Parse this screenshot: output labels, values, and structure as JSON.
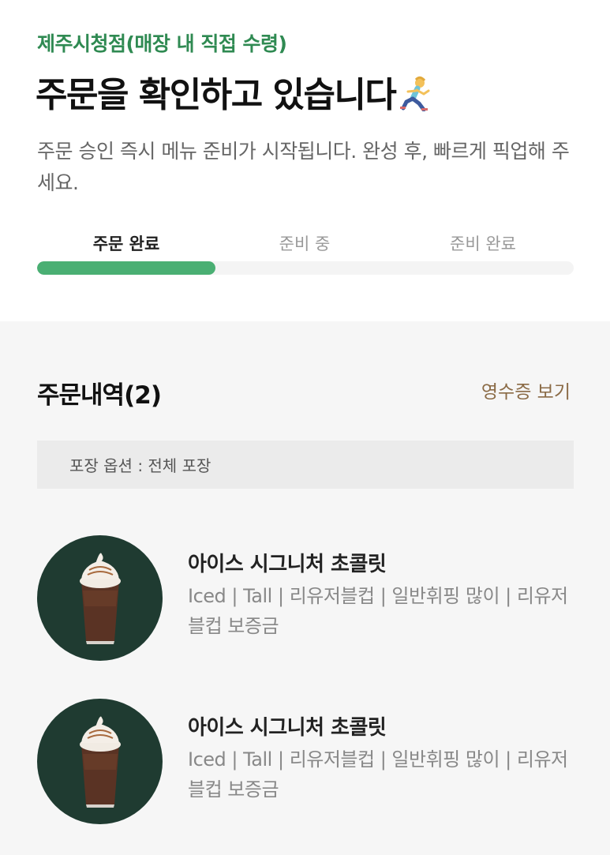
{
  "header": {
    "store": "제주시청점(매장 내 직접 수령)",
    "title": "주문을 확인하고 있습니다",
    "description": "주문 승인 즉시 메뉴 준비가 시작됩니다. 완성 후, 빠르게 픽업해 주세요."
  },
  "progress": {
    "steps": [
      {
        "label": "주문 완료",
        "active": true
      },
      {
        "label": "준비 중",
        "active": false
      },
      {
        "label": "준비 완료",
        "active": false
      }
    ],
    "completed_fraction": 0.333,
    "accent_color": "#4aaf73"
  },
  "order": {
    "title": "주문내역(2)",
    "receipt_link": "영수증 보기",
    "packaging": "포장 옵션 : 전체 포장",
    "items": [
      {
        "name": "아이스 시그니처 초콜릿",
        "options": "Iced | Tall | 리유저블컵 | 일반휘핑 많이 | 리유저블컵 보증금",
        "icon": "iced-chocolate-drink-image"
      },
      {
        "name": "아이스 시그니처 초콜릿",
        "options": "Iced | Tall | 리유저블컵 | 일반휘핑 많이 | 리유저블컵 보증금",
        "icon": "iced-chocolate-drink-image"
      }
    ]
  },
  "colors": {
    "store_green": "#2f8a52",
    "thumb_bg": "#1f3b31",
    "receipt_brown": "#8a6a45"
  }
}
